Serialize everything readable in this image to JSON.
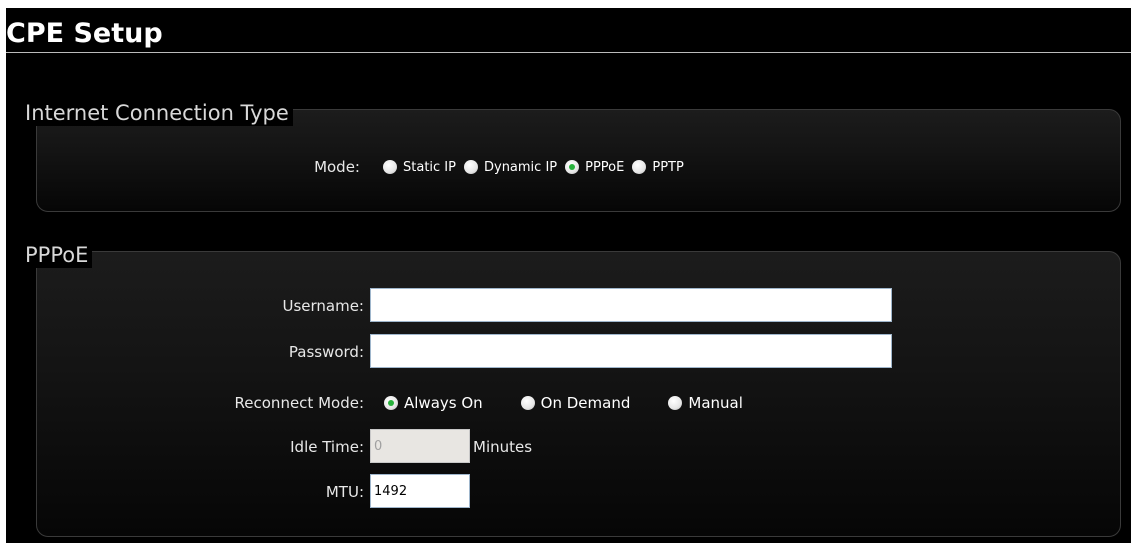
{
  "page": {
    "title": "CPE Setup"
  },
  "connection": {
    "legend": "Internet Connection Type",
    "mode_label": "Mode:",
    "options": [
      {
        "label": "Static IP",
        "checked": false
      },
      {
        "label": "Dynamic IP",
        "checked": false
      },
      {
        "label": "PPPoE",
        "checked": true
      },
      {
        "label": "PPTP",
        "checked": false
      }
    ]
  },
  "pppoe": {
    "legend": "PPPoE",
    "username": {
      "label": "Username:",
      "value": ""
    },
    "password": {
      "label": "Password:",
      "value": ""
    },
    "reconnect": {
      "label": "Reconnect Mode:",
      "options": [
        {
          "label": "Always On",
          "checked": true
        },
        {
          "label": "On Demand",
          "checked": false
        },
        {
          "label": "Manual",
          "checked": false
        }
      ]
    },
    "idle_time": {
      "label": "Idle Time:",
      "value": "0",
      "unit": "Minutes",
      "disabled": true
    },
    "mtu": {
      "label": "MTU:",
      "value": "1492"
    }
  },
  "colors": {
    "background": "#000000",
    "accent_radio": "#27b13b",
    "text": "#ffffff"
  }
}
